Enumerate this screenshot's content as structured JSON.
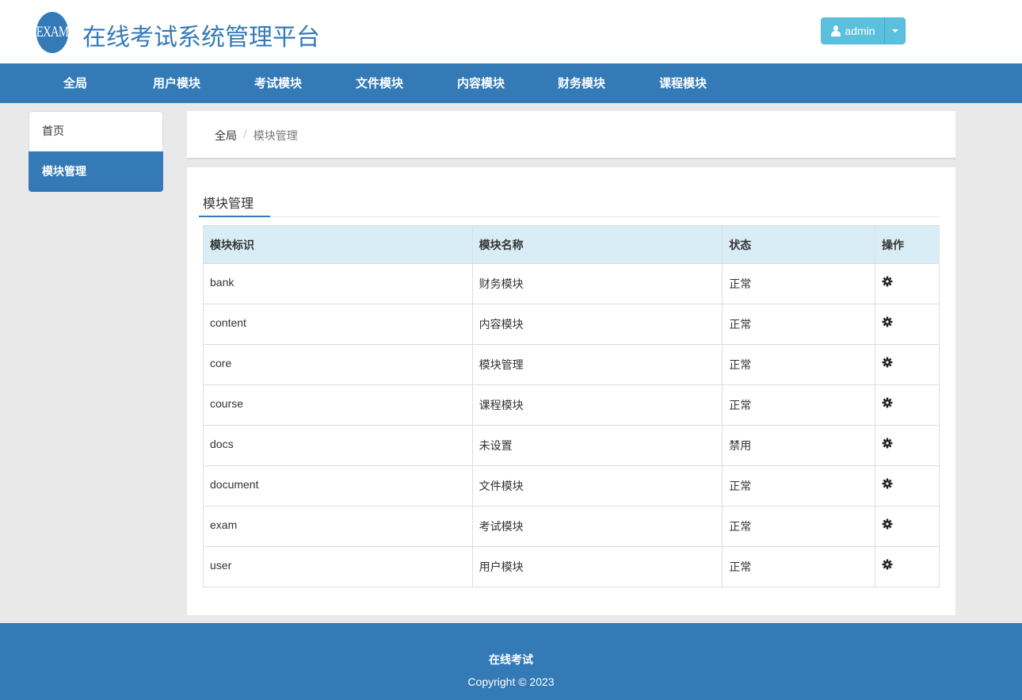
{
  "header": {
    "logo_text": "EXAM",
    "title": "在线考试系统管理平台",
    "user_label": "admin"
  },
  "nav": {
    "items": [
      {
        "label": "全局"
      },
      {
        "label": "用户模块"
      },
      {
        "label": "考试模块"
      },
      {
        "label": "文件模块"
      },
      {
        "label": "内容模块"
      },
      {
        "label": "财务模块"
      },
      {
        "label": "课程模块"
      }
    ]
  },
  "sidebar": {
    "items": [
      {
        "label": "首页"
      },
      {
        "label": "模块管理"
      }
    ]
  },
  "breadcrumb": {
    "root": "全局",
    "separator": "/",
    "current": "模块管理"
  },
  "main": {
    "tab_label": "模块管理",
    "table": {
      "headers": [
        "模块标识",
        "模块名称",
        "状态",
        "操作"
      ],
      "rows": [
        {
          "id": "bank",
          "name": "财务模块",
          "status": "正常"
        },
        {
          "id": "content",
          "name": "内容模块",
          "status": "正常"
        },
        {
          "id": "core",
          "name": "模块管理",
          "status": "正常"
        },
        {
          "id": "course",
          "name": "课程模块",
          "status": "正常"
        },
        {
          "id": "docs",
          "name": "未设置",
          "status": "禁用"
        },
        {
          "id": "document",
          "name": "文件模块",
          "status": "正常"
        },
        {
          "id": "exam",
          "name": "考试模块",
          "status": "正常"
        },
        {
          "id": "user",
          "name": "用户模块",
          "status": "正常"
        }
      ]
    }
  },
  "footer": {
    "line1": "在线考试",
    "line2": "Copyright © 2023"
  },
  "colors": {
    "primary": "#337ab7",
    "info": "#5bc0de",
    "table_header": "#d9edf7"
  },
  "icons": {
    "user_icon": "user-icon",
    "caret_icon": "caret-down-icon",
    "action_icon": "gear-icon"
  }
}
